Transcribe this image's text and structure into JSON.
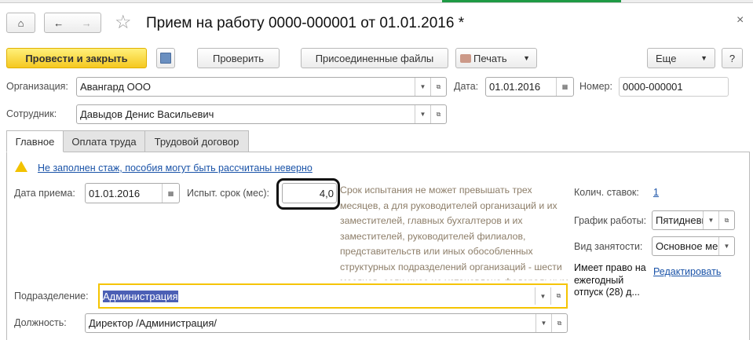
{
  "window": {
    "title": "Прием на работу 0000-000001 от 01.01.2016 *",
    "close_icon": "×"
  },
  "toolbar": {
    "post_close": "Провести и закрыть",
    "check": "Проверить",
    "attached_files": "Присоединенные файлы",
    "print": "Печать",
    "more": "Еще",
    "help": "?"
  },
  "header": {
    "organization_label": "Организация:",
    "organization_value": "Авангард ООО",
    "date_label": "Дата:",
    "date_value": "01.01.2016",
    "number_label": "Номер:",
    "number_value": "0000-000001",
    "employee_label": "Сотрудник:",
    "employee_value": "Давыдов Денис Васильевич"
  },
  "tabs": [
    {
      "label": "Главное",
      "active": true
    },
    {
      "label": "Оплата труда"
    },
    {
      "label": "Трудовой договор"
    }
  ],
  "main": {
    "warning_link": "Не заполнен стаж, пособия могут быть рассчитаны неверно",
    "hire_date_label": "Дата приема:",
    "hire_date_value": "01.01.2016",
    "probation_label": "Испыт. срок (мес):",
    "probation_value": "4,0",
    "probation_hint": "Срок испытания не может превышать трех месяцев, а для руководителей организаций и их заместителей, главных бухгалтеров и их заместителей, руководителей филиалов, представительств или иных обособленных структурных подразделений организаций - шести месяцев, если иное не установлено федеральным законом.",
    "rates_label": "Колич. ставок:",
    "rates_value": "1",
    "schedule_label": "График работы:",
    "schedule_value": "Пятидневка",
    "employment_label": "Вид занятости:",
    "employment_value": "Основное место работы",
    "vacation_text": "Имеет право на ежегодный отпуск (28) д...",
    "vacation_edit": "Редактировать",
    "department_label": "Подразделение:",
    "department_value": "Администрация",
    "position_label": "Должность:",
    "position_value": "Директор /Администрация/"
  },
  "colors": {
    "accent_yellow": "#f5c820",
    "link": "#1a53a8",
    "hint": "#8d7e69",
    "selection": "#4b5fb5"
  }
}
